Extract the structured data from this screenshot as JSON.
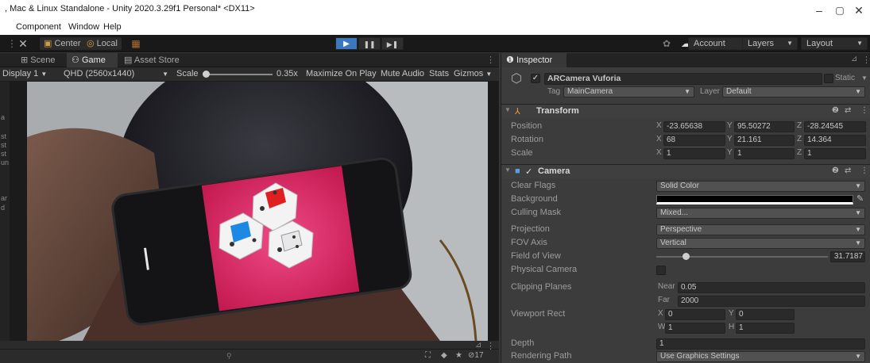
{
  "window": {
    "title": ", Mac & Linux Standalone - Unity 2020.3.29f1 Personal* <DX11>",
    "minimize": "–",
    "maximize": "▢",
    "close": "✕"
  },
  "menu": [
    "Component",
    "Window",
    "Help"
  ],
  "toolbar": {
    "center_label": "Center",
    "local_label": "Local",
    "play": "▶",
    "pause": "❚❚",
    "step": "▶❚",
    "account_label": "Account",
    "layers_label": "Layers",
    "layout_label": "Layout"
  },
  "game_view": {
    "tabs": [
      "Scene",
      "Game",
      "Asset Store"
    ],
    "display": "Display 1",
    "resolution": "QHD (2560x1440)",
    "scale_label": "Scale",
    "scale_value": "0.35x",
    "scale_level": 0.05,
    "maximize_on_play": "Maximize On Play",
    "mute_audio": "Mute Audio",
    "stats": "Stats",
    "gizmos": "Gizmos",
    "left_strip_chars": [
      "a",
      "st",
      "st",
      "st",
      "un",
      "ar",
      "d"
    ],
    "bottom_count": "17"
  },
  "inspector": {
    "tab_label": "Inspector",
    "object_name": "ARCamera Vuforia",
    "static_label": "Static",
    "tag_label": "Tag",
    "tag_value": "MainCamera",
    "layer_label": "Layer",
    "layer_value": "Default",
    "transform": {
      "title": "Transform",
      "position_label": "Position",
      "rotation_label": "Rotation",
      "scale_label": "Scale",
      "position": {
        "x": "-23.65638",
        "y": "95.50272",
        "z": "-28.24545"
      },
      "rotation": {
        "x": "68",
        "y": "21.161",
        "z": "14.364"
      },
      "scale": {
        "x": "1",
        "y": "1",
        "z": "1"
      }
    },
    "camera": {
      "title": "Camera",
      "clear_flags_label": "Clear Flags",
      "clear_flags": "Solid Color",
      "background_label": "Background",
      "background_color": "#000000",
      "culling_mask_label": "Culling Mask",
      "culling_mask": "Mixed...",
      "projection_label": "Projection",
      "projection": "Perspective",
      "fov_axis_label": "FOV Axis",
      "fov_axis": "Vertical",
      "fov_label": "Field of View",
      "fov_value": "31.7187",
      "fov_level": 0.17,
      "physical_camera_label": "Physical Camera",
      "clipping_label": "Clipping Planes",
      "near_label": "Near",
      "near": "0.05",
      "far_label": "Far",
      "far": "2000",
      "viewport_label": "Viewport Rect",
      "viewport": {
        "x": "0",
        "y": "0",
        "w": "1",
        "h": "1"
      },
      "depth_label": "Depth",
      "depth": "1",
      "rendering_path_label": "Rendering Path",
      "rendering_path": "Use Graphics Settings"
    },
    "axis_labels": {
      "x": "X",
      "y": "Y",
      "z": "Z",
      "w": "W",
      "h": "H"
    }
  },
  "colors": {
    "play_active": "#3a79bb",
    "viewport_pink": "#e0306e",
    "die_red": "#e02020",
    "die_blue": "#1e88e5"
  }
}
